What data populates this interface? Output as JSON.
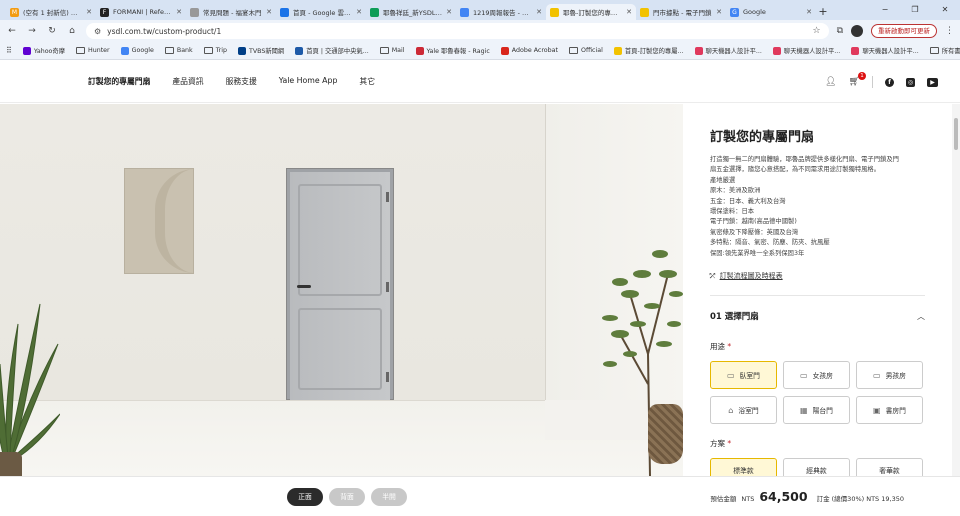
{
  "browser": {
    "tabs": [
      {
        "title": "(空有 1 封新信) Mail",
        "fav_color": "#f39c12",
        "fav": "M",
        "active": false
      },
      {
        "title": "FORMANI | Reference",
        "fav_color": "#222222",
        "fav": "F",
        "active": false
      },
      {
        "title": "常見問題 - 福宴木門",
        "fav_color": "#999999",
        "fav": "",
        "active": false
      },
      {
        "title": "首頁 - Google 雲端硬碟",
        "fav_color": "#1a73e8",
        "fav": "",
        "active": false
      },
      {
        "title": "耶魯祥廷_新YSDL_sh",
        "fav_color": "#0f9d58",
        "fav": "",
        "active": false
      },
      {
        "title": "1219周報報告 - Goo",
        "fav_color": "#4285f4",
        "fav": "",
        "active": false
      },
      {
        "title": "耶魯-訂製您的專屬門",
        "fav_color": "#f2c200",
        "fav": "",
        "active": true
      },
      {
        "title": "門市據點 - 電子門鎖",
        "fav_color": "#f2c200",
        "fav": "",
        "active": false
      },
      {
        "title": "Google",
        "fav_color": "#4285f4",
        "fav": "G",
        "active": false
      }
    ],
    "new_tab": "+",
    "window_controls": [
      "−",
      "❐",
      "✕"
    ],
    "url": "ysdl.com.tw/custom-product/1",
    "update_button": "重新啟動即可更新",
    "bookmarks": [
      {
        "label": "Yahoo奇摩",
        "type": "site",
        "color": "#6001d2"
      },
      {
        "label": "Hunter",
        "type": "folder"
      },
      {
        "label": "Google",
        "type": "site",
        "color": "#4285f4"
      },
      {
        "label": "Bank",
        "type": "folder"
      },
      {
        "label": "Trip",
        "type": "folder"
      },
      {
        "label": "TVBS新聞網",
        "type": "site",
        "color": "#003f87"
      },
      {
        "label": "首頁 | 交通部中央氣...",
        "type": "site",
        "color": "#1e5aa8"
      },
      {
        "label": "Mail",
        "type": "folder"
      },
      {
        "label": "Yale 耶魯春報 - Ragic",
        "type": "site",
        "color": "#cc2936"
      },
      {
        "label": "Adobe Acrobat",
        "type": "site",
        "color": "#d9261c"
      },
      {
        "label": "Official",
        "type": "folder"
      },
      {
        "label": "首頁-訂製您的專屬...",
        "type": "site",
        "color": "#f2c200"
      },
      {
        "label": "聊天機器人設計平...",
        "type": "site",
        "color": "#e0395d"
      },
      {
        "label": "聊天機器人設計平...",
        "type": "site",
        "color": "#e0395d"
      },
      {
        "label": "聊天機器人設計平...",
        "type": "site",
        "color": "#e0395d"
      }
    ],
    "all_bookmarks": "所有書籤"
  },
  "site": {
    "nav": [
      "訂製您的專屬門扇",
      "產品資訊",
      "服務支援",
      "Yale Home App",
      "其它"
    ],
    "cart_count": "1"
  },
  "config": {
    "title": "訂製您的專屬門扇",
    "description_lines": [
      "打造獨一無二的門扇體驗，耶魯品牌提供多樣化門扇、電子門鎖及門",
      "扇五金選擇，隨您心意搭配，為不同需求用途訂製獨特風格。",
      "產地嚴選",
      "原木：美洲及歐洲",
      "五金：日本、義大利及台灣",
      "環保塗料：日本",
      "電子門鎖：越南(高品德中國製)",
      "氣密條及下降壓條：英國及台灣",
      "多特點：隔音、氣密、防塵、防夾、抗風壓",
      "保固:領先業界唯一全系列保固3年"
    ],
    "process_link": "訂製流程圖及時程表",
    "step_title": "01 選擇門扇",
    "usage_label": "用途",
    "usage_options": [
      {
        "label": "臥室門",
        "icon": "bed-icon",
        "glyph": "▭",
        "selected": true
      },
      {
        "label": "女孩房",
        "icon": "bed-icon",
        "glyph": "▭",
        "selected": false
      },
      {
        "label": "男孩房",
        "icon": "bed-icon",
        "glyph": "▭",
        "selected": false
      },
      {
        "label": "浴室門",
        "icon": "bathtub-icon",
        "glyph": "⌂",
        "selected": false
      },
      {
        "label": "陽台門",
        "icon": "window-icon",
        "glyph": "▦",
        "selected": false
      },
      {
        "label": "書房門",
        "icon": "monitor-icon",
        "glyph": "▣",
        "selected": false
      }
    ],
    "plan_label": "方案",
    "plan_options": [
      {
        "label": "標準款",
        "selected": true
      },
      {
        "label": "經典款",
        "selected": false
      },
      {
        "label": "奢華款",
        "selected": false
      }
    ]
  },
  "bottom": {
    "view_buttons": [
      {
        "label": "正面",
        "active": true
      },
      {
        "label": "背面",
        "active": false
      },
      {
        "label": "半開",
        "active": false
      }
    ],
    "price_label": "預估金額",
    "currency": "NTS",
    "price": "64,500",
    "deposit": "訂金 (總價30%) NTS 19,350"
  },
  "colors": {
    "accent": "#e6b800",
    "accent_bg": "#fff8d6",
    "required": "#c0272d"
  }
}
